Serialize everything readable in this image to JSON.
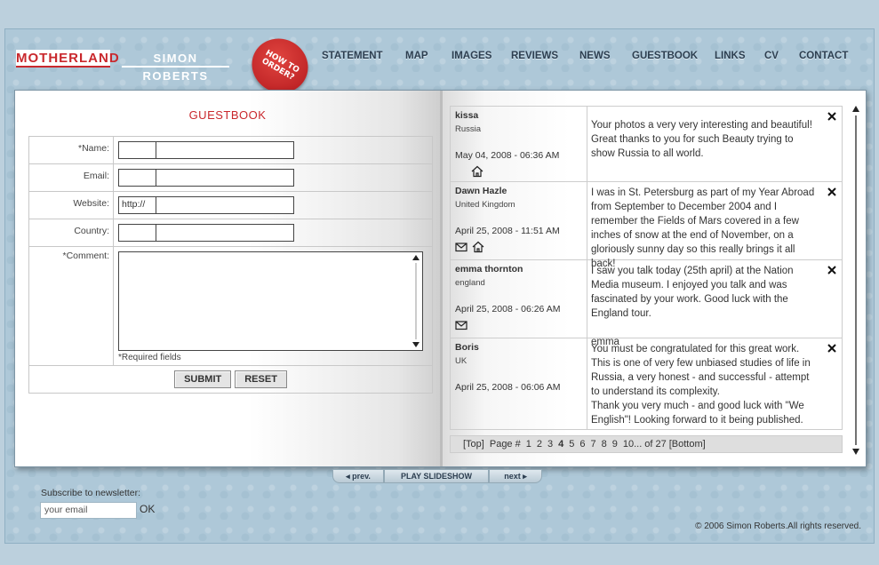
{
  "header": {
    "logo_motherland": "MOTHERLAND",
    "logo_simon": "SIMON ROBERTS",
    "order_badge": "HOW TO ORDER?"
  },
  "nav": {
    "items": [
      "STATEMENT",
      "MAP",
      "IMAGES",
      "REVIEWS",
      "NEWS",
      "GUESTBOOK",
      "LINKS",
      "CV",
      "CONTACT"
    ]
  },
  "guestbook_form": {
    "title": "GUESTBOOK",
    "name_label": "*Name:",
    "email_label": "Email:",
    "website_label": "Website:",
    "website_prefix": "http://",
    "country_label": "Country:",
    "comment_label": "*Comment:",
    "required_note": "*Required fields",
    "submit_label": "SUBMIT",
    "reset_label": "RESET"
  },
  "entries": [
    {
      "name": "kissa",
      "country": "Russia",
      "date": "May 04, 2008 - 06:36 AM",
      "icons": [
        "home-icon"
      ],
      "message": "Your photos a very very interesting and beautiful! Great thanks to you for such Beauty trying to show Russia to all world."
    },
    {
      "name": "Dawn Hazle",
      "country": "United Kingdom",
      "date": "April 25, 2008 - 11:51 AM",
      "icons": [
        "mail-icon",
        "home-icon"
      ],
      "message": "I was in St. Petersburg as part of my Year Abroad from September to December 2004 and I remember the Fields of Mars covered in a few inches of snow at the end of November, on a gloriously sunny day so this really brings it all back!"
    },
    {
      "name": "emma thornton",
      "country": "england",
      "date": "April 25, 2008 - 06:26 AM",
      "icons": [
        "mail-icon"
      ],
      "message": "I saw you talk today (25th april) at the Nation Media museum. I enjoyed you talk and was fascinated by your work. Good luck with the England tour.",
      "signature": "emma"
    },
    {
      "name": "Boris",
      "country": "UK",
      "date": "April 25, 2008 - 06:06 AM",
      "icons": [],
      "message": "You must be congratulated for this great work. This is one of very few unbiased studies of life in Russia, a very honest - and successful - attempt to understand its complexity.",
      "message2": "Thank you very much - and good luck with \"We English\"! Looking forward to it being published."
    }
  ],
  "pager": {
    "top": "[Top]",
    "page_label": "Page #",
    "pages": [
      "1",
      "2",
      "3",
      "4",
      "5",
      "6",
      "7",
      "8",
      "9",
      "10..."
    ],
    "current": "4",
    "total": "of 27",
    "bottom": "[Bottom]"
  },
  "slideshow": {
    "prev": "prev.",
    "play": "PLAY SLIDESHOW",
    "next": "next"
  },
  "newsletter": {
    "label": "Subscribe to newsletter:",
    "placeholder": "your email",
    "ok": "OK"
  },
  "footer": {
    "copyright": "© 2006 Simon Roberts.All rights reserved."
  }
}
